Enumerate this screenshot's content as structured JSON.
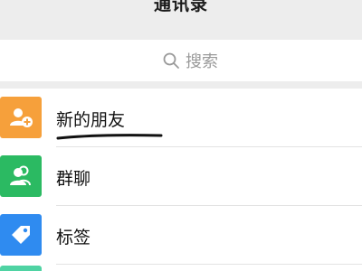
{
  "header": {
    "title": "通讯录"
  },
  "search": {
    "placeholder": "搜索"
  },
  "list": {
    "items": [
      {
        "label": "新的朋友",
        "icon": "add-friend-icon",
        "color": "#f6a03b"
      },
      {
        "label": "群聊",
        "icon": "group-chat-icon",
        "color": "#2bba62"
      },
      {
        "label": "标签",
        "icon": "tag-icon",
        "color": "#2f8bf0"
      }
    ],
    "partial_item_color": "#4fd3a3"
  },
  "colors": {
    "background": "#ededed",
    "card": "#ffffff",
    "text": "#111111",
    "placeholder": "#9a9a9a"
  }
}
